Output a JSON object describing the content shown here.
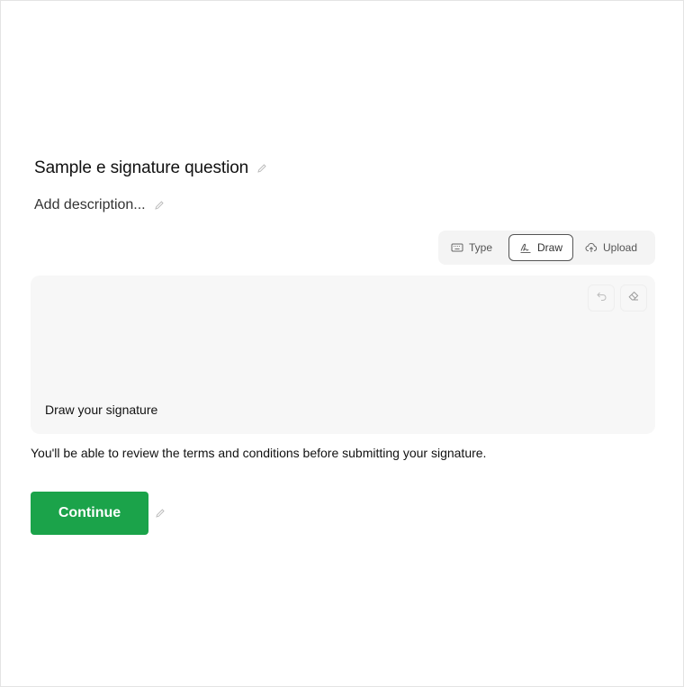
{
  "question": {
    "title": "Sample e signature question",
    "description_placeholder": "Add description..."
  },
  "signature_modes": [
    {
      "label": "Type",
      "icon": "keyboard-icon",
      "selected": false
    },
    {
      "label": "Draw",
      "icon": "signature-icon",
      "selected": true
    },
    {
      "label": "Upload",
      "icon": "cloud-upload-icon",
      "selected": false
    }
  ],
  "pad": {
    "hint": "Draw your signature",
    "tools": [
      "undo-icon",
      "eraser-icon"
    ]
  },
  "terms_notice": "You'll be able to review the terms and conditions before submitting your signature.",
  "continue_button": {
    "label": "Continue",
    "color": "#1ba34a"
  },
  "colors": {
    "accent": "#1ba34a",
    "pad_background": "#f7f7f7"
  }
}
